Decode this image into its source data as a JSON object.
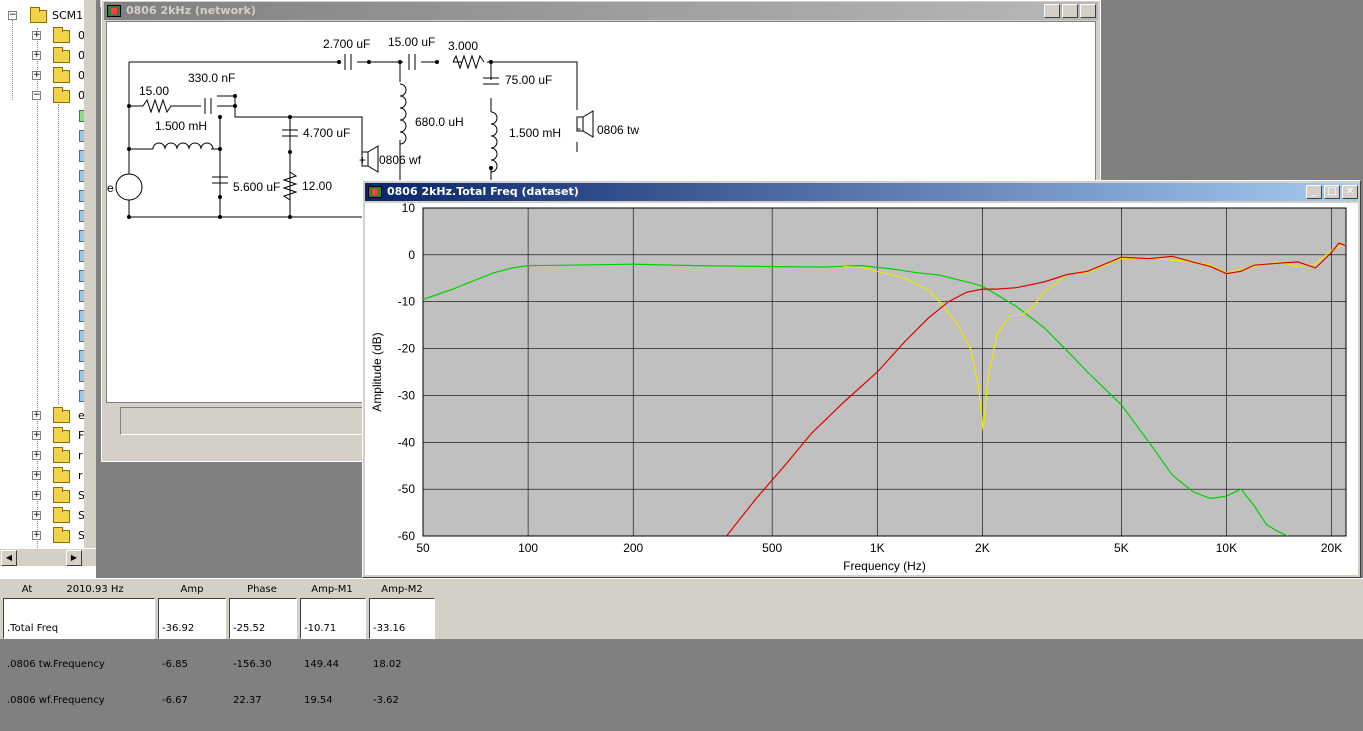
{
  "tree": {
    "root_label": "SCM1",
    "items": [
      {
        "label": "0",
        "expand": "+"
      },
      {
        "label": "0",
        "expand": "+"
      },
      {
        "label": "0",
        "expand": "+"
      },
      {
        "label": "0",
        "expand": "−"
      }
    ],
    "lower_items": [
      {
        "label": "e",
        "expand": "+"
      },
      {
        "label": "F",
        "expand": "+"
      },
      {
        "label": "r",
        "expand": "+"
      },
      {
        "label": "r",
        "expand": "+"
      },
      {
        "label": "S",
        "expand": "+"
      },
      {
        "label": "S",
        "expand": "+"
      },
      {
        "label": "S",
        "expand": "+"
      }
    ]
  },
  "network_window": {
    "title": "0806 2kHz (network)",
    "components": {
      "c_series_1": "2.700 uF",
      "c_series_2": "15.00 uF",
      "r_series": "3.000",
      "c_shunt_tw": "75.00 uF",
      "l_shunt_mid": "680.0 uH",
      "l_shunt_tw": "1.500 mH",
      "tweeter": "0806 tw",
      "r_notch": "15.00",
      "c_notch": "330.0 nF",
      "l_woofer": "1.500 mH",
      "c_zobel": "4.700 uF",
      "c_shunt_wf": "5.600 uF",
      "r_zobel": "12.00",
      "woofer": "0806 wf",
      "source_label": "e",
      "plus": "+",
      "minus": "-"
    }
  },
  "graph_window": {
    "title": "0806 2kHz.Total Freq (dataset)"
  },
  "chart_data": {
    "type": "line",
    "xscale": "log",
    "xlabel": "Frequency (Hz)",
    "ylabel": "Amplitude (dB)",
    "xlim": [
      50,
      22000
    ],
    "ylim": [
      -60,
      10
    ],
    "xticks": [
      {
        "v": 50,
        "label": "50"
      },
      {
        "v": 100,
        "label": "100"
      },
      {
        "v": 200,
        "label": "200"
      },
      {
        "v": 500,
        "label": "500"
      },
      {
        "v": 1000,
        "label": "1K"
      },
      {
        "v": 2000,
        "label": "2K"
      },
      {
        "v": 5000,
        "label": "5K"
      },
      {
        "v": 10000,
        "label": "10K"
      },
      {
        "v": 20000,
        "label": "20K"
      }
    ],
    "yticks": [
      10,
      0,
      -10,
      -20,
      -30,
      -40,
      -50,
      -60
    ],
    "grid": true,
    "series": [
      {
        "color": "#00d000",
        "points": [
          [
            50,
            -9.5
          ],
          [
            60,
            -7.5
          ],
          [
            70,
            -5.5
          ],
          [
            80,
            -3.8
          ],
          [
            90,
            -2.8
          ],
          [
            100,
            -2.3
          ],
          [
            130,
            -2.2
          ],
          [
            200,
            -2.0
          ],
          [
            300,
            -2.3
          ],
          [
            500,
            -2.5
          ],
          [
            700,
            -2.6
          ],
          [
            900,
            -2.3
          ],
          [
            1100,
            -3.0
          ],
          [
            1300,
            -3.8
          ],
          [
            1500,
            -4.3
          ],
          [
            1700,
            -5.3
          ],
          [
            1900,
            -6.2
          ],
          [
            2000,
            -6.7
          ],
          [
            2200,
            -8.5
          ],
          [
            2500,
            -11.0
          ],
          [
            3000,
            -15.5
          ],
          [
            3500,
            -20.5
          ],
          [
            4000,
            -25.0
          ],
          [
            5000,
            -32.0
          ],
          [
            6000,
            -40.0
          ],
          [
            7000,
            -47.0
          ],
          [
            8000,
            -50.5
          ],
          [
            9000,
            -52.0
          ],
          [
            10000,
            -51.5
          ],
          [
            11000,
            -50.0
          ],
          [
            12000,
            -53.5
          ],
          [
            13000,
            -57.5
          ],
          [
            14000,
            -59.0
          ],
          [
            15000,
            -60.0
          ]
        ]
      },
      {
        "color": "#e8e800",
        "points": [
          [
            800,
            -2.5
          ],
          [
            900,
            -2.7
          ],
          [
            1000,
            -3.5
          ],
          [
            1200,
            -5.0
          ],
          [
            1400,
            -7.5
          ],
          [
            1550,
            -11.0
          ],
          [
            1700,
            -15.0
          ],
          [
            1850,
            -20.0
          ],
          [
            1950,
            -28.0
          ],
          [
            2010,
            -37.5
          ],
          [
            2070,
            -27.0
          ],
          [
            2200,
            -17.0
          ],
          [
            2400,
            -13.0
          ],
          [
            2600,
            -12.8
          ],
          [
            2800,
            -11.0
          ],
          [
            3000,
            -8.0
          ],
          [
            3500,
            -4.2
          ],
          [
            4000,
            -3.8
          ],
          [
            5000,
            -0.8
          ],
          [
            6000,
            -0.7
          ],
          [
            8000,
            -1.5
          ],
          [
            9000,
            -2.2
          ],
          [
            10000,
            -3.8
          ],
          [
            12000,
            -2.5
          ],
          [
            14000,
            -1.5
          ],
          [
            16000,
            -2.5
          ],
          [
            18000,
            -2.0
          ],
          [
            20000,
            1.0
          ],
          [
            22000,
            2.2
          ]
        ]
      },
      {
        "color": "#e00000",
        "points": [
          [
            370,
            -60.0
          ],
          [
            450,
            -52.0
          ],
          [
            550,
            -44.5
          ],
          [
            650,
            -38.0
          ],
          [
            800,
            -31.5
          ],
          [
            1000,
            -25.0
          ],
          [
            1200,
            -18.5
          ],
          [
            1400,
            -13.5
          ],
          [
            1600,
            -10.0
          ],
          [
            1800,
            -8.0
          ],
          [
            2000,
            -7.3
          ],
          [
            2200,
            -7.3
          ],
          [
            2500,
            -7.0
          ],
          [
            3000,
            -5.8
          ],
          [
            3500,
            -4.2
          ],
          [
            4000,
            -3.5
          ],
          [
            5000,
            -0.5
          ],
          [
            6000,
            -0.8
          ],
          [
            7000,
            -0.3
          ],
          [
            8000,
            -1.5
          ],
          [
            9000,
            -2.5
          ],
          [
            10000,
            -4.0
          ],
          [
            11000,
            -3.5
          ],
          [
            12000,
            -2.2
          ],
          [
            14000,
            -1.8
          ],
          [
            16000,
            -1.5
          ],
          [
            18000,
            -2.8
          ],
          [
            20000,
            0.5
          ],
          [
            21000,
            2.5
          ],
          [
            22000,
            2.0
          ]
        ]
      }
    ]
  },
  "readout": {
    "at_label": "At",
    "at_value": "2010.93 Hz",
    "headers": [
      "Amp",
      "Phase",
      "Amp-M1",
      "Amp-M2"
    ],
    "rows": [
      {
        "name": ".Total Freq",
        "amp": "-36.92",
        "phase": "-25.52",
        "m1": "-10.71",
        "m2": "-33.16"
      },
      {
        "name": ".0806 tw.Frequency",
        "amp": "-6.85",
        "phase": "-156.30",
        "m1": "149.44",
        "m2": "18.02"
      },
      {
        "name": ".0806 wf.Frequency",
        "amp": "-6.67",
        "phase": "22.37",
        "m1": "19.54",
        "m2": "-3.62"
      }
    ]
  }
}
